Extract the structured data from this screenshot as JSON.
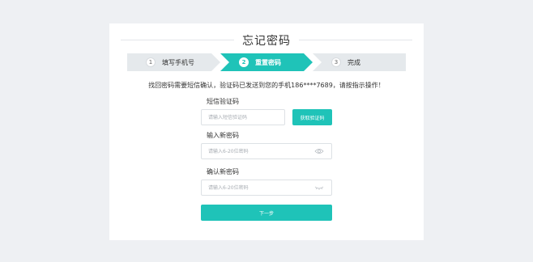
{
  "page": {
    "title": "忘记密码"
  },
  "steps": [
    {
      "num": "1",
      "label": "填写手机号"
    },
    {
      "num": "2",
      "label": "重置密码"
    },
    {
      "num": "3",
      "label": "完成"
    }
  ],
  "colors": {
    "accent": "#1fc3b8",
    "step_inactive": "#e5e9ec",
    "page_bg": "#eef0f3"
  },
  "message": "找回密码需要短信确认，验证码已发送到您的手机186****7689，请按指示操作！",
  "form": {
    "sms": {
      "label": "短信验证码",
      "placeholder": "请输入短信验证码",
      "button": "获取验证码"
    },
    "new_password": {
      "label": "输入新密码",
      "placeholder": "请输入6-20位密码"
    },
    "confirm_password": {
      "label": "确认新密码",
      "placeholder": "请输入6-20位密码"
    },
    "next_button": "下一步"
  },
  "icons": {
    "show_password": "eye-icon",
    "hide_password": "eye-closed-icon"
  }
}
